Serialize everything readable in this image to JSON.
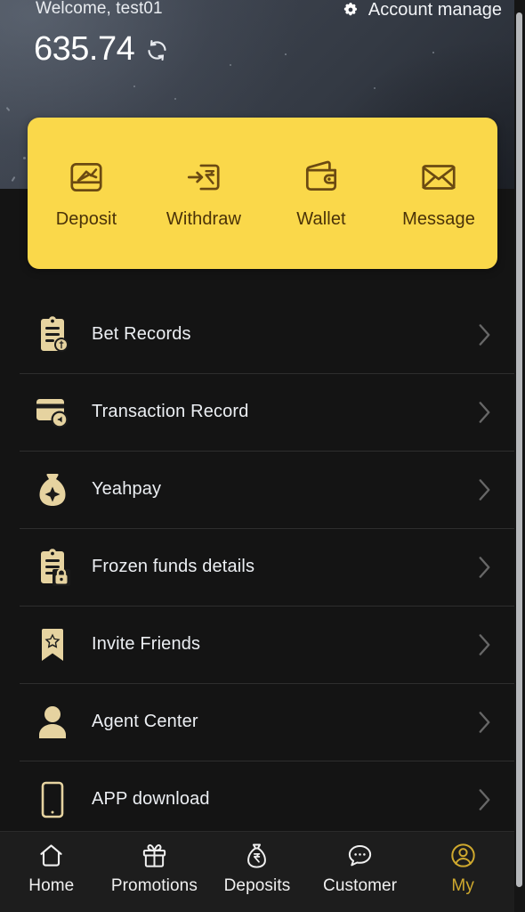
{
  "header": {
    "welcome_text": "Welcome, test01",
    "balance": "635.74",
    "account_manage_label": "Account manage",
    "gear_icon": "gear-icon",
    "refresh_icon": "refresh-icon"
  },
  "quick_actions": [
    {
      "label": "Deposit",
      "icon": "deposit-icon"
    },
    {
      "label": "Withdraw",
      "icon": "withdraw-rupee-icon"
    },
    {
      "label": "Wallet",
      "icon": "wallet-icon"
    },
    {
      "label": "Message",
      "icon": "envelope-icon"
    }
  ],
  "menu": [
    {
      "label": "Bet Records",
      "icon": "clipboard-coin-icon"
    },
    {
      "label": "Transaction Record",
      "icon": "card-history-icon"
    },
    {
      "label": "Yeahpay",
      "icon": "money-bag-icon"
    },
    {
      "label": "Frozen funds details",
      "icon": "clipboard-lock-icon"
    },
    {
      "label": "Invite Friends",
      "icon": "bookmark-star-icon"
    },
    {
      "label": "Agent Center",
      "icon": "person-icon"
    },
    {
      "label": "APP download",
      "icon": "mobile-phone-icon"
    }
  ],
  "bottom_nav": [
    {
      "label": "Home",
      "icon": "home-icon",
      "active": false
    },
    {
      "label": "Promotions",
      "icon": "gift-icon",
      "active": false
    },
    {
      "label": "Deposits",
      "icon": "money-bag-rupee-icon",
      "active": false
    },
    {
      "label": "Customer",
      "icon": "chat-bubble-icon",
      "active": false
    },
    {
      "label": "My",
      "icon": "user-circle-icon",
      "active": true
    }
  ],
  "colors": {
    "accent_yellow": "#fad84a",
    "icon_gold": "#e6d3a0",
    "active_nav": "#cfa92e",
    "page_bg": "#141414",
    "icon_brown": "#6b4a12"
  }
}
